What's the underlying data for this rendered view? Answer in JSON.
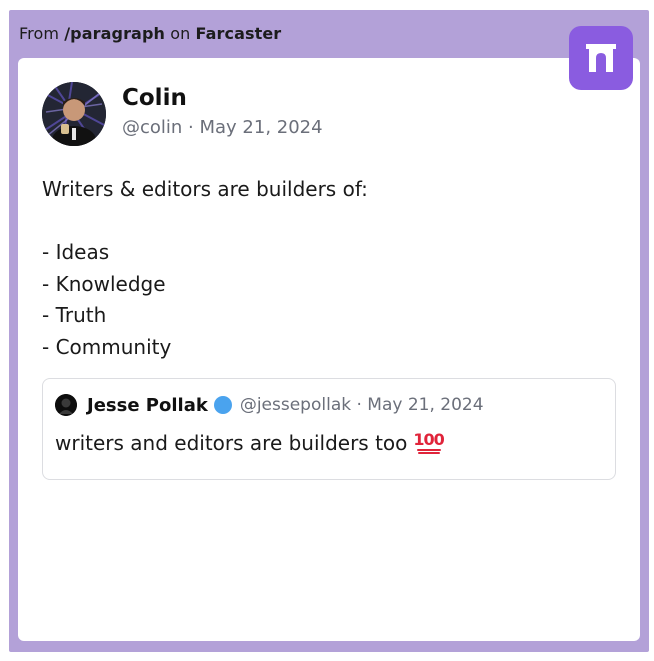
{
  "source": {
    "prefix": "From",
    "channel": "/paragraph",
    "connector": "on",
    "platform": "Farcaster"
  },
  "brand": {
    "icon": "paragraph-arch-logo-icon",
    "color": "#8a5ce0"
  },
  "post": {
    "author_name": "Colin",
    "author_meta": "@colin · May 21, 2024",
    "lines": [
      "Writers & editors are builders of:",
      "",
      "- Ideas",
      "- Knowledge",
      "- Truth",
      "- Community"
    ]
  },
  "quote": {
    "author_name": "Jesse Pollak",
    "verified_icon": "verified-badge-icon",
    "author_meta": "@jessepollak · May 21, 2024",
    "text": "writers and editors are builders too",
    "emoji": "💯"
  },
  "colors": {
    "frame": "#b3a1d8",
    "card": "#ffffff",
    "verified": "#4aa3ee",
    "emoji": "#e0243a"
  }
}
